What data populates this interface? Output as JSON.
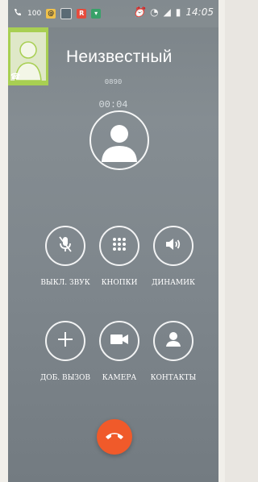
{
  "status_bar": {
    "battery_text": "100",
    "time": "14:05"
  },
  "call": {
    "name": "Неизвестный",
    "number": "0890",
    "timer": "00:04"
  },
  "controls": {
    "row1": [
      {
        "label": "ВЫКЛ. ЗВУК",
        "icon": "mic-off-icon"
      },
      {
        "label": "КНОПКИ",
        "icon": "keypad-icon"
      },
      {
        "label": "ДИНАМИК",
        "icon": "speaker-icon"
      }
    ],
    "row2": [
      {
        "label": "ДОБ. ВЫЗОВ",
        "icon": "plus-icon"
      },
      {
        "label": "КАМЕРА",
        "icon": "camera-icon"
      },
      {
        "label": "КОНТАКТЫ",
        "icon": "person-icon"
      }
    ]
  },
  "colors": {
    "avatar_green": "#a8cf52",
    "end_call": "#f05a2a"
  }
}
